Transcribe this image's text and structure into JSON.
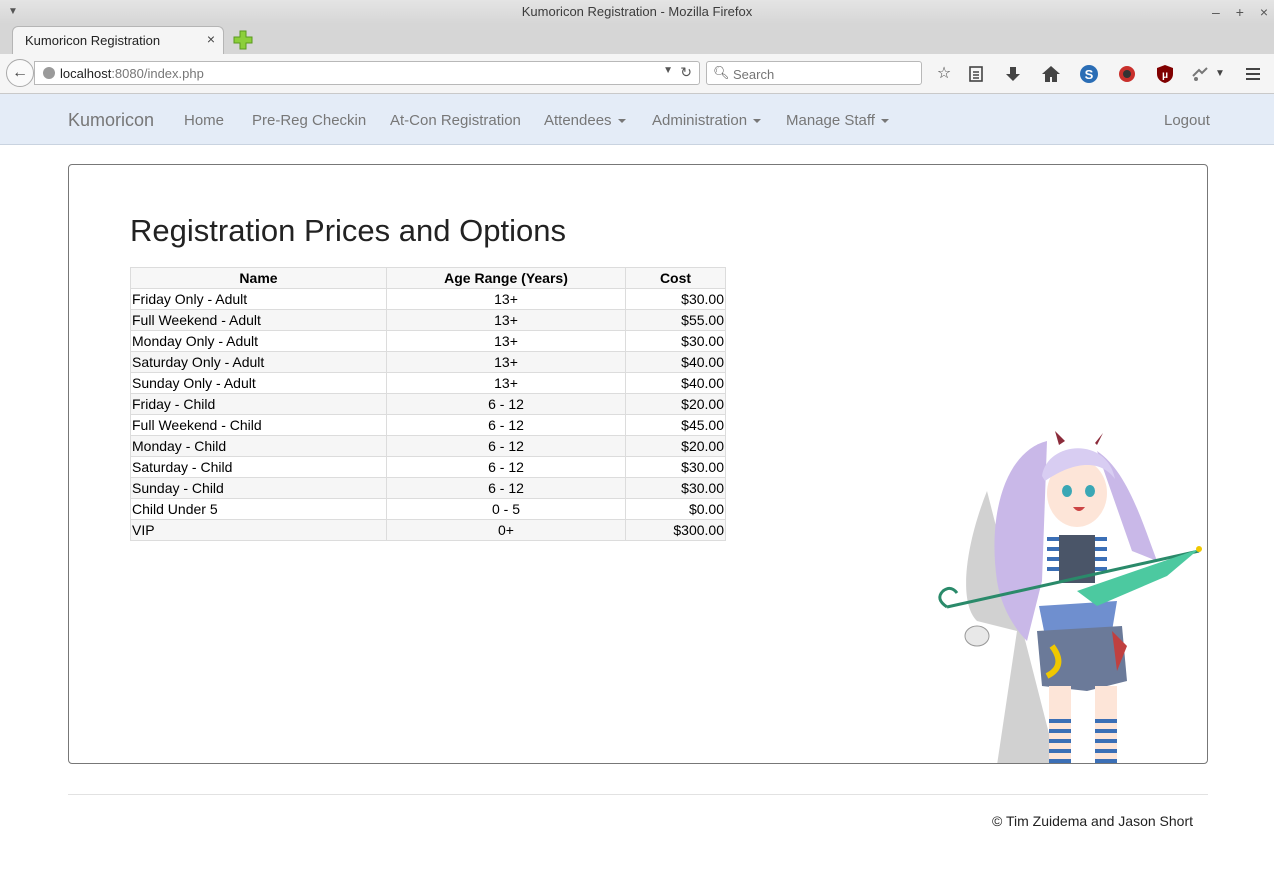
{
  "window": {
    "title": "Kumoricon Registration - Mozilla Firefox",
    "controls": [
      "–",
      "+",
      "×"
    ]
  },
  "browser": {
    "tab_title": "Kumoricon Registration",
    "tab_close": "×",
    "url_host": "localhost",
    "url_rest": ":8080/index.php",
    "search_placeholder": "Search"
  },
  "nav": {
    "brand": "Kumoricon",
    "home": "Home",
    "prereg": "Pre-Reg Checkin",
    "atcon": "At-Con Registration",
    "attendees": "Attendees",
    "administration": "Administration",
    "manage_staff": "Manage Staff",
    "logout": "Logout"
  },
  "main": {
    "title": "Registration Prices and Options",
    "columns": [
      "Name",
      "Age Range (Years)",
      "Cost"
    ],
    "rows": [
      [
        "Friday Only - Adult",
        "13+",
        "$30.00"
      ],
      [
        "Full Weekend - Adult",
        "13+",
        "$55.00"
      ],
      [
        "Monday Only - Adult",
        "13+",
        "$30.00"
      ],
      [
        "Saturday Only - Adult",
        "13+",
        "$40.00"
      ],
      [
        "Sunday Only - Adult",
        "13+",
        "$40.00"
      ],
      [
        "Friday - Child",
        "6 - 12",
        "$20.00"
      ],
      [
        "Full Weekend - Child",
        "6 - 12",
        "$45.00"
      ],
      [
        "Monday - Child",
        "6 - 12",
        "$20.00"
      ],
      [
        "Saturday - Child",
        "6 - 12",
        "$30.00"
      ],
      [
        "Sunday - Child",
        "6 - 12",
        "$30.00"
      ],
      [
        "Child Under 5",
        "0 - 5",
        "$0.00"
      ],
      [
        "VIP",
        "0+",
        "$300.00"
      ]
    ]
  },
  "footer": {
    "text": "© Tim Zuidema and Jason Short"
  },
  "colors": {
    "navbar_bg": "#e4ecf7",
    "nav_text": "#777777"
  }
}
